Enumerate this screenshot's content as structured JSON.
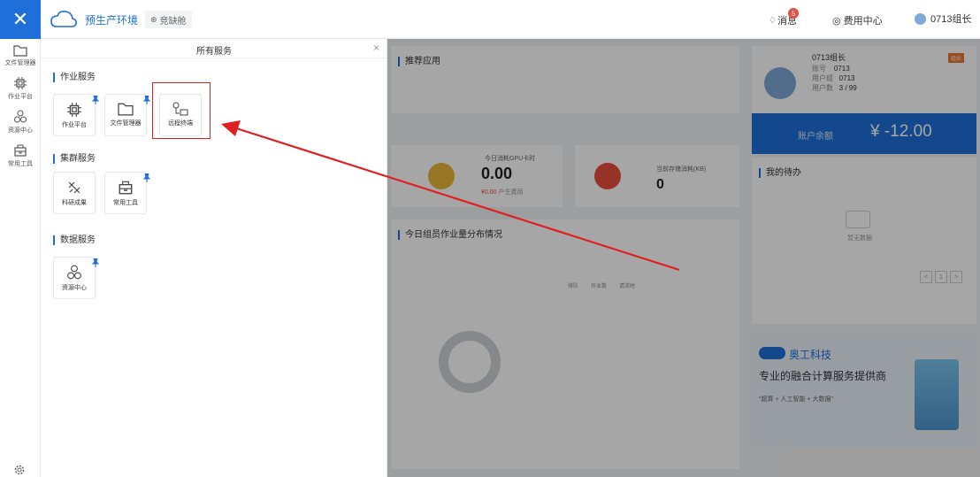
{
  "topbar": {
    "close_icon": "close-icon",
    "env_title": "预生产环境",
    "env_badge": "竞缺舱",
    "messages_label": "消息",
    "messages_count": "5",
    "fee_center": "费用中心",
    "username": "0713组长"
  },
  "rail": {
    "items": [
      {
        "label": "文件管理器",
        "icon": "folder-icon"
      },
      {
        "label": "作业平台",
        "icon": "chip-icon"
      },
      {
        "label": "资源中心",
        "icon": "hexagons-icon"
      },
      {
        "label": "常用工具",
        "icon": "toolbox-icon"
      }
    ],
    "settings_icon": "gear-icon"
  },
  "panel": {
    "title": "所有服务",
    "close": "×",
    "sections": [
      {
        "title": "作业服务",
        "tiles": [
          "作业平台",
          "文件管理器",
          "远程终端"
        ]
      },
      {
        "title": "集群服务",
        "tiles": [
          "科研成果",
          "常用工具"
        ]
      },
      {
        "title": "数据服务",
        "tiles": [
          "资源中心"
        ]
      }
    ]
  },
  "dashboard": {
    "recommended_apps": "推荐应用",
    "gpu_today_label": "今日消耗GPU卡时",
    "gpu_today_value": "0.00",
    "gpu_cost": "¥0.00",
    "gpu_cost_label": "产生费用",
    "storage_label": "当前存储消耗(KB)",
    "storage_value": "0",
    "job_dist_title": "今日组员作业量分布情况",
    "legend": [
      "排队",
      "作业数",
      "请求时"
    ],
    "user_card": {
      "name": "0713组长",
      "account_label": "账号",
      "account_value": "0713",
      "group_label": "用户组",
      "group_value": "0713",
      "count_label": "用户数",
      "count_value": "3 / 99",
      "badge": "组长"
    },
    "balance_label": "账户余额",
    "balance_value": "¥ -12.00",
    "todo_title": "我的待办",
    "todo_empty": "暂无数据",
    "pager": [
      "<",
      "1",
      ">"
    ],
    "ad_brand": "奥工科技",
    "ad_slogan": "专业的融合计算服务提供商",
    "ad_sub": "\"超算 + 人工智能 + 大数据\""
  },
  "colors": {
    "accent": "#1e6fd9",
    "highlight": "#e02020",
    "danger": "#e94d3f",
    "gpu_icon": "#e8b73a"
  }
}
